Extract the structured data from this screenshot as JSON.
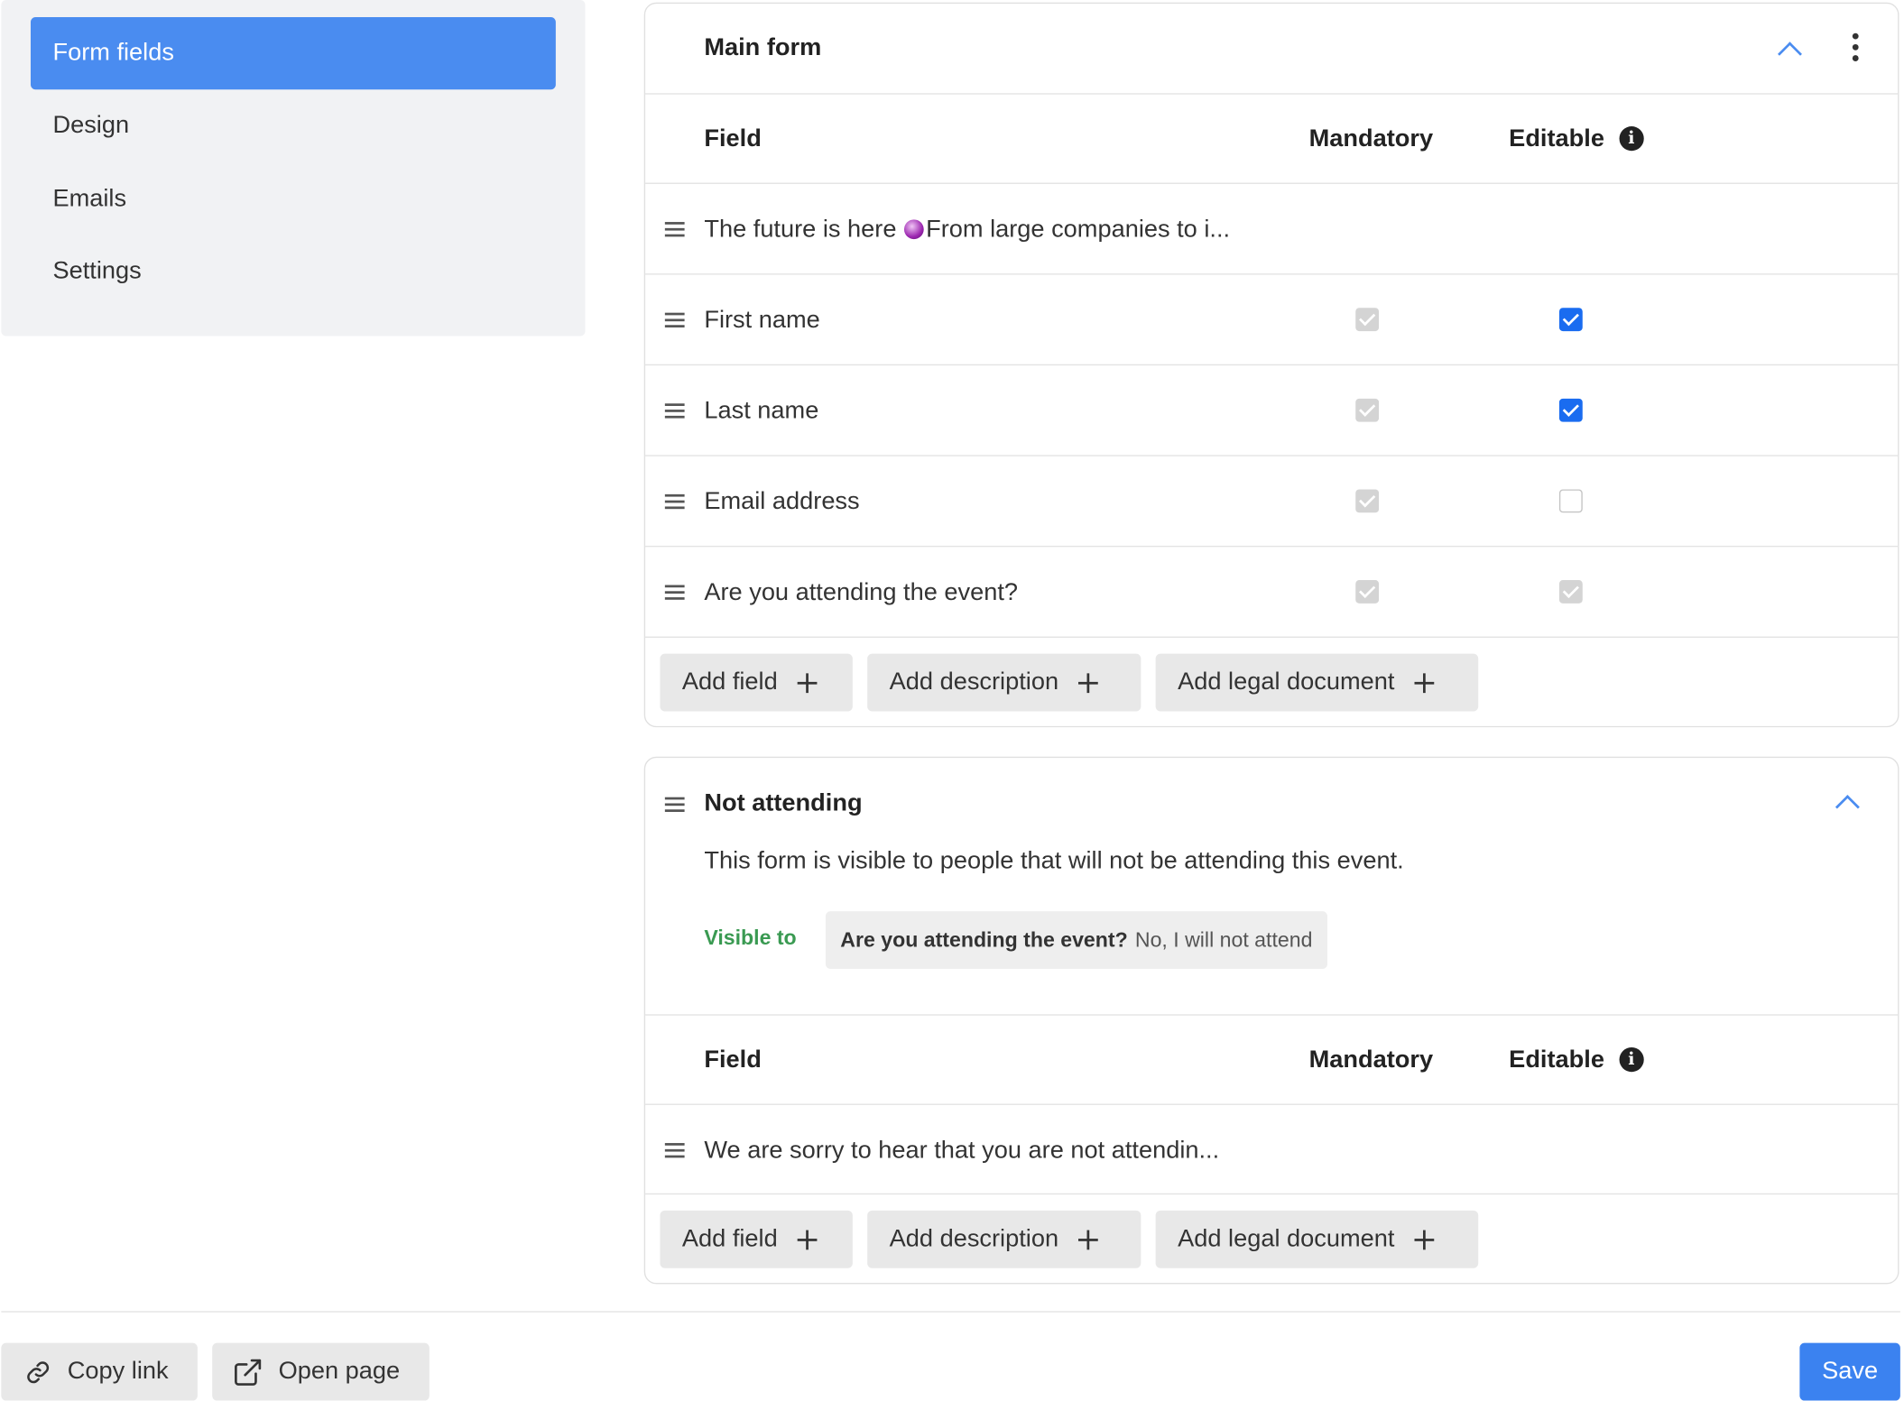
{
  "sidebar": {
    "items": [
      {
        "label": "Form fields",
        "active": true
      },
      {
        "label": "Design"
      },
      {
        "label": "Emails"
      },
      {
        "label": "Settings"
      }
    ]
  },
  "main_form": {
    "title": "Main form",
    "columns": {
      "field": "Field",
      "mandatory": "Mandatory",
      "editable": "Editable"
    },
    "rows": [
      {
        "label_start": "The future is here ",
        "label_end": "From large companies to i...",
        "kind": "description"
      },
      {
        "label": "First name",
        "mandatory": "locked-checked",
        "editable": "checked"
      },
      {
        "label": "Last name",
        "mandatory": "locked-checked",
        "editable": "checked"
      },
      {
        "label": "Email address",
        "mandatory": "locked-checked",
        "editable": "unchecked"
      },
      {
        "label": "Are you attending the event?",
        "mandatory": "locked-checked",
        "editable": "locked-checked"
      }
    ],
    "buttons": {
      "add_field": "Add field",
      "add_description": "Add description",
      "add_legal": "Add legal document"
    }
  },
  "not_attending": {
    "title": "Not attending",
    "description": "This form is visible to people that will not be attending this event.",
    "visible_to_label": "Visible to",
    "condition_question": "Are you attending the event?",
    "condition_answer": "No, I will not attend",
    "columns": {
      "field": "Field",
      "mandatory": "Mandatory",
      "editable": "Editable"
    },
    "rows": [
      {
        "label": "We are sorry to hear that you are not attendin...",
        "kind": "description"
      }
    ],
    "buttons": {
      "add_field": "Add field",
      "add_description": "Add description",
      "add_legal": "Add legal document"
    }
  },
  "footer": {
    "copy_link": "Copy link",
    "open_page": "Open page",
    "save": "Save"
  },
  "colors": {
    "accent": "#4a8cf0",
    "visible_to": "#3a9a52",
    "checkbox_checked": "#1a6cf0"
  }
}
